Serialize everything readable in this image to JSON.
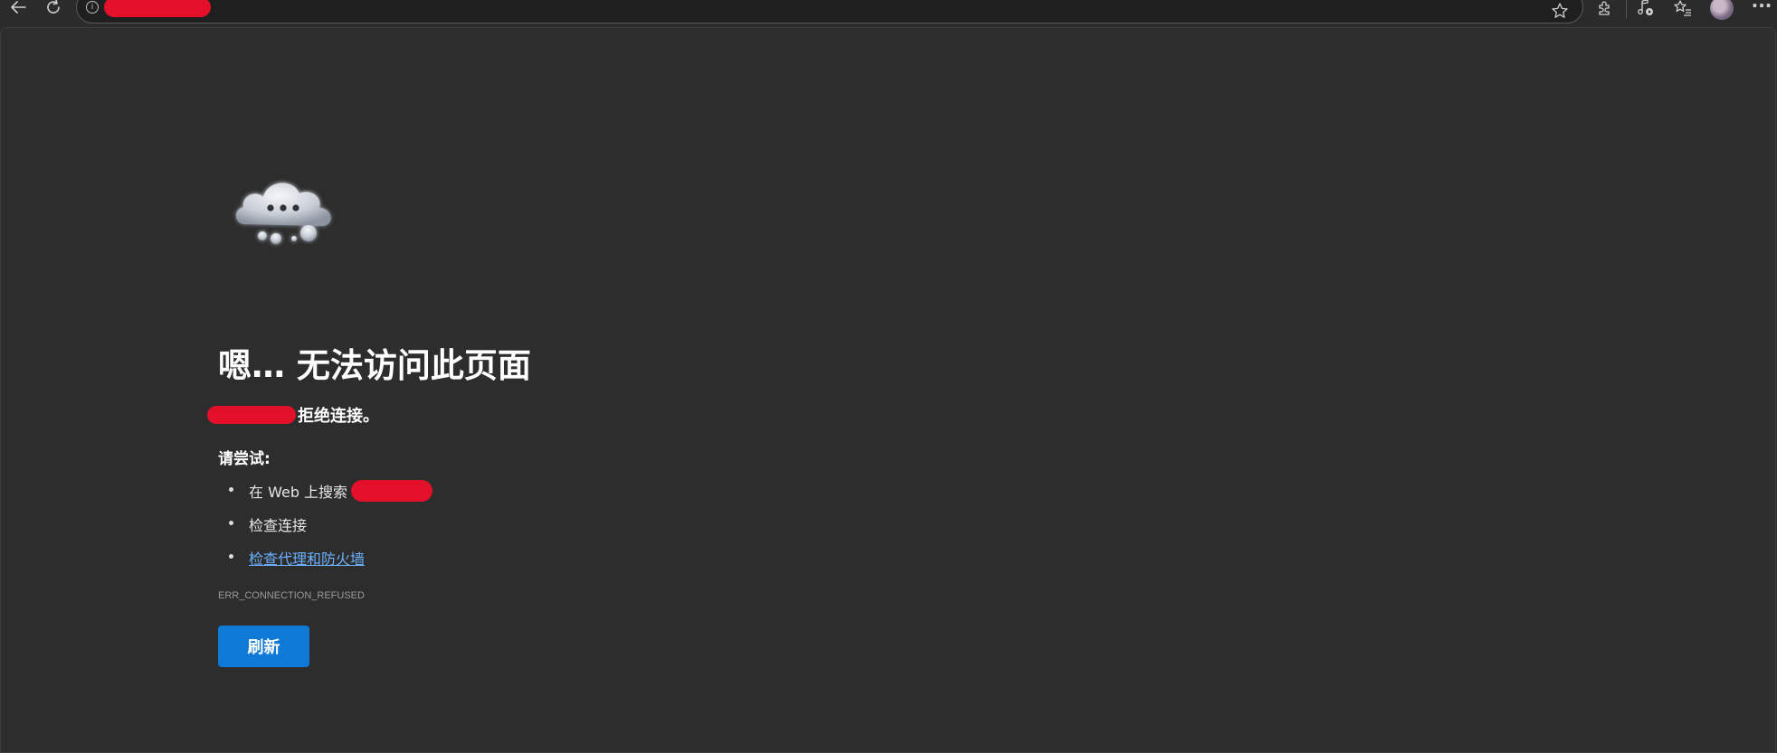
{
  "browser": {
    "back_icon": "back-arrow-icon",
    "reload_icon": "reload-icon",
    "address": {
      "info_icon": "info-icon",
      "url": ""
    },
    "toolbar_icons": [
      "favorite-star-icon",
      "extensions-icon",
      "media-playback-icon",
      "favorites-list-icon",
      "profile-avatar",
      "more-menu-icon"
    ]
  },
  "page": {
    "illustration": "cloud-ellipsis-icon",
    "heading": "嗯… 无法访问此页面",
    "message_suffix": "拒绝连接。",
    "try_label": "请尝试:",
    "suggestions": {
      "search_prefix": "在 Web 上搜索",
      "check_connection": "检查连接",
      "check_proxy_firewall": "检查代理和防火墙"
    },
    "error_code": "ERR_CONNECTION_REFUSED",
    "refresh_label": "刷新"
  },
  "colors": {
    "background": "#2d2d2d",
    "accent_button": "#0f79d6",
    "link": "#6cb0ff",
    "redaction": "#e3102a"
  }
}
